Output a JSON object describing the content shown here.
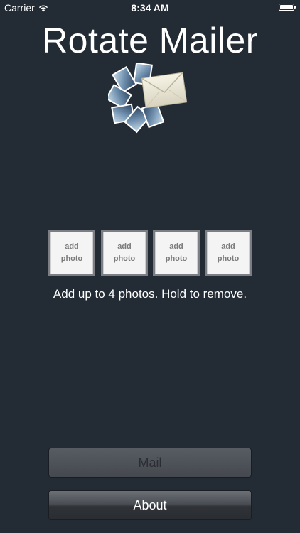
{
  "status_bar": {
    "carrier": "Carrier",
    "time": "8:34 AM",
    "wifi_icon": "wifi-icon",
    "battery_icon": "battery-icon"
  },
  "app": {
    "title": "Rotate Mailer",
    "logo_icon": "rotating-photos-envelope-logo"
  },
  "photo_slots": [
    {
      "line1": "add",
      "line2": "photo"
    },
    {
      "line1": "add",
      "line2": "photo"
    },
    {
      "line1": "add",
      "line2": "photo"
    },
    {
      "line1": "add",
      "line2": "photo"
    }
  ],
  "hint": "Add up to 4 photos. Hold to remove.",
  "buttons": {
    "mail": "Mail",
    "about": "About"
  },
  "colors": {
    "background": "#232b34",
    "slot_background": "#f4f4f4",
    "slot_border": "#7b7f84",
    "mail_text": "#2a2d31"
  }
}
